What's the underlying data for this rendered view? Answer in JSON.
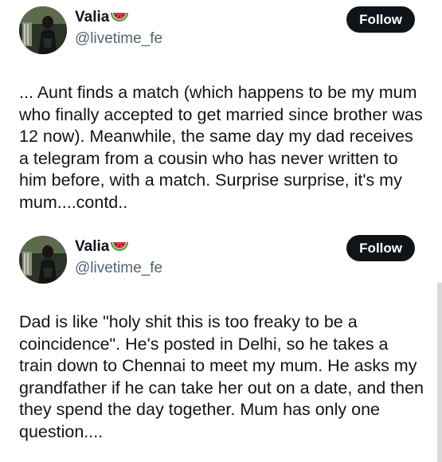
{
  "tweets": [
    {
      "name": "Valia",
      "handle": "@livetime_fe",
      "follow_label": "Follow",
      "name_emoji": "watermelon-icon",
      "text": "... Aunt finds a match (which happens to be my mum who finally accepted to get married since brother was 12 now). Meanwhile, the same day my dad receives a telegram from a cousin who has never written to him before, with a match. Surprise surprise, it's my mum....contd.."
    },
    {
      "name": "Valia",
      "handle": "@livetime_fe",
      "follow_label": "Follow",
      "name_emoji": "watermelon-icon",
      "text": "Dad is like \"holy shit this is too freaky to be a coincidence\". He's posted in Delhi, so he takes a train down to Chennai to meet my mum. He asks my grandfather if he can take her out on a date, and then they spend the day together. Mum has only one question...."
    }
  ],
  "colors": {
    "text": "#0f1419",
    "secondary": "#536471",
    "button_bg": "#0f1419",
    "button_text": "#ffffff"
  }
}
